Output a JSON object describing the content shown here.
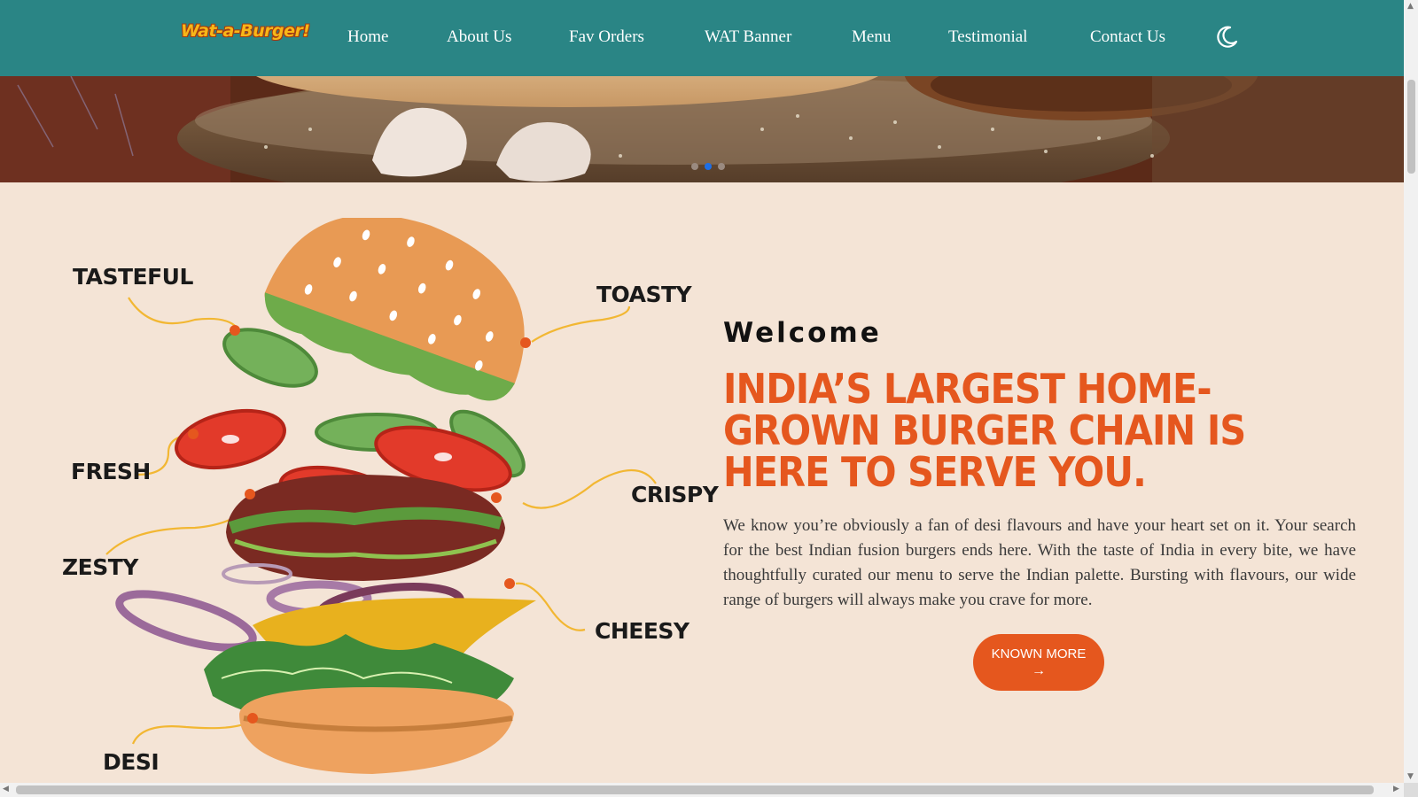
{
  "brand": {
    "logo_text": "Wat-a-Burger!"
  },
  "nav": {
    "items": [
      "Home",
      "About Us",
      "Fav Orders",
      "WAT Banner",
      "Menu",
      "Testimonial",
      "Contact Us"
    ],
    "theme_toggle_icon": "moon-icon"
  },
  "hero": {
    "carousel_active_index": 1,
    "carousel_count": 3
  },
  "burger_tags": [
    "TASTEFUL",
    "TOASTY",
    "FRESH",
    "CRISPY",
    "ZESTY",
    "CHEESY",
    "DESI"
  ],
  "main": {
    "welcome": "Welcome",
    "headline": "INDIA’S LARGEST HOME-GROWN BURGER CHAIN IS HERE TO SERVE YOU.",
    "description": "We know you’re obviously a fan of desi flavours and have your heart set on it. Your search for the best Indian fusion burgers ends here. With the taste of India in every bite, we have thoughtfully curated our menu to serve the Indian palette. Bursting with flavours, our wide range of burgers will always make you crave for more.",
    "cta_label": "KNOWN MORE",
    "cta_icon": "arrow-right-icon"
  },
  "colors": {
    "nav_bg": "#2a8585",
    "accent": "#e5571e",
    "page_bg": "#f4e4d6"
  }
}
